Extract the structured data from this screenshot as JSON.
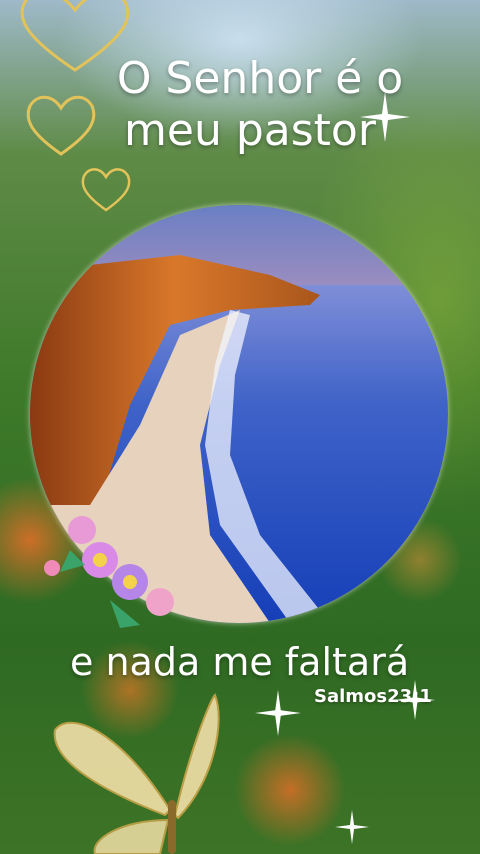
{
  "title": {
    "line1": "O Senhor é o",
    "line2": "meu pastor"
  },
  "subtitle": "e nada me faltará",
  "reference": "Salmos23:1",
  "decorations": {
    "hearts": "heart-outline-icon",
    "flowers": "flower-cluster-icon",
    "butterfly": "butterfly-icon",
    "sparkles": "sparkle-icon"
  },
  "colors": {
    "text": "#ffffff",
    "gold": "#e2c35a",
    "ocean": "#1f5fd0"
  }
}
